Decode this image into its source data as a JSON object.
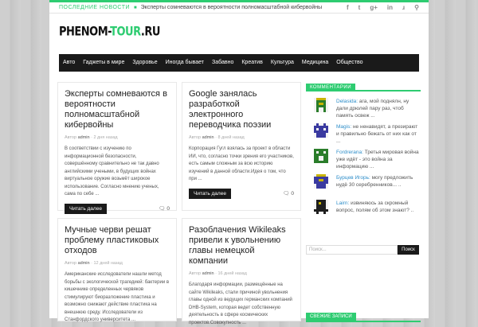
{
  "topbar": {
    "label": "Последние новости",
    "ticker": "Эксперты сомневаются в вероятности полномасштабной кибервойны",
    "socials": [
      "facebook-icon",
      "twitter-icon",
      "google-plus-icon",
      "linkedin-icon",
      "rss-icon",
      "search-icon"
    ]
  },
  "logo": {
    "part1": "PHENOM-",
    "part2": "TOUR",
    "part3": ".RU"
  },
  "nav": [
    "Авто",
    "Гаджеты в мире",
    "Здоровье",
    "Иногда бывает",
    "Забавно",
    "Креатив",
    "Культура",
    "Медицина",
    "Общество"
  ],
  "posts": [
    {
      "title": "Эксперты сомневаются в вероятности полномасштабной кибервойны",
      "author_label": "Автор",
      "author": "admin",
      "date": "· 2 дня назад",
      "excerpt": "В соответствии с изучению по информационной безопасности, совершённому сравнительно не так давно английскими учеными, в будущих войнах виртуальное оружие возьмёт широкое использование. Согласно мнению ученых, сама по себе ...",
      "button": "Читать далее",
      "comments": "0"
    },
    {
      "title": "Google занялась разработкой электронного переводчика поэзии",
      "author_label": "Автор",
      "author": "admin",
      "date": "· 8 дней назад",
      "excerpt": "Корпорация Гугл взялась за проект в области ИИ, что, согласно точки зрения его участников, есть самым сложным за всю историю изучений в данной области.Идея о том, что при ...",
      "button": "Читать далее",
      "comments": "0"
    },
    {
      "title": "Мучные черви решат проблему пластиковых отходов",
      "author_label": "Автор",
      "author": "admin",
      "date": "· 12 дней назад",
      "excerpt": "Американские исследователи нашли метод борьбы с экологической трагедией: бактерии в кишечнике определенных червяков стимулируют биоразложение пластика и возможно снижают действие пластика на внешнюю среду. Исследователи из Станфордского университета ..."
    },
    {
      "title": "Разоблачения Wikileaks привели к увольнению главы немецкой компании",
      "author_label": "Автор",
      "author": "admin",
      "date": "· 16 дней назад",
      "excerpt": "Благодаря информации, размещённые на сайте Wikileaks, стали причиной увольнения главы одной из ведущих германских компаний DHB-System, которая ведет собственную деятельность в сфере космических проектов.Совокупность ..."
    }
  ],
  "sidebar": {
    "comments_title": "Комментарии",
    "comments": [
      {
        "name": "Delasida:",
        "text": "ага, мой поднялн, ну дали дрюлей пару раз, чтоб память освеж ...",
        "color": "#2a7d2a"
      },
      {
        "name": "Magis:",
        "text": "не ненавидят, а презирают и правильно бежать от них как от ...",
        "color": "#3a3aa0"
      },
      {
        "name": "Fordrerana:",
        "text": "Третья мировая война уже идёт - это война за информацию ...",
        "color": "#2a7d2a"
      },
      {
        "name": "Бурцев Игорь:",
        "text": "могу предложить нудё 30 серебренников... ..",
        "color": "#3a3aa0"
      },
      {
        "name": "Lairn:",
        "text": "извиняюсь за скромный вопрос, полям об этом знают? ..",
        "color": "#1e1e1e"
      }
    ],
    "search_placeholder": "Поиск...",
    "search_button": "Поиск",
    "fresh_title": "Свежие записи"
  }
}
